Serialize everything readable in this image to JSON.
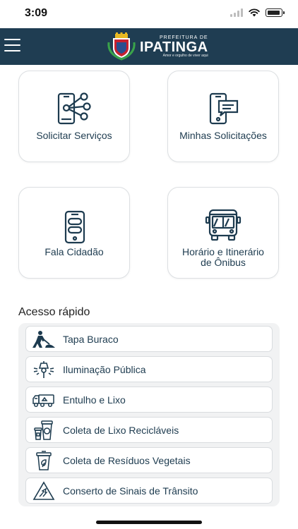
{
  "status": {
    "time": "3:09"
  },
  "header": {
    "logo_pre": "PREFEITURA DE",
    "logo_name": "IPATINGA",
    "logo_slogan": "Amor e orgulho de viver aqui"
  },
  "cards": [
    {
      "label": "Solicitar Serviços",
      "icon": "phone-network-icon"
    },
    {
      "label": "Minhas Solicitações",
      "icon": "phone-chat-icon"
    },
    {
      "label": "Fala Cidadão",
      "icon": "phone-messages-icon"
    },
    {
      "label": "Horário e Itinerário de Ônibus",
      "icon": "bus-icon"
    }
  ],
  "quick_access": {
    "title": "Acesso rápido",
    "items": [
      {
        "label": "Tapa Buraco",
        "icon": "worker-shoveling-icon"
      },
      {
        "label": "Iluminação Pública",
        "icon": "street-lamp-icon"
      },
      {
        "label": "Entulho e Lixo",
        "icon": "garbage-truck-icon"
      },
      {
        "label": "Coleta de Lixo Recicláveis",
        "icon": "recycling-bins-icon"
      },
      {
        "label": "Coleta de Resíduos Vegetais",
        "icon": "organic-bin-icon"
      },
      {
        "label": "Conserto de Sinais de Trânsito",
        "icon": "traffic-sign-icon"
      }
    ]
  }
}
